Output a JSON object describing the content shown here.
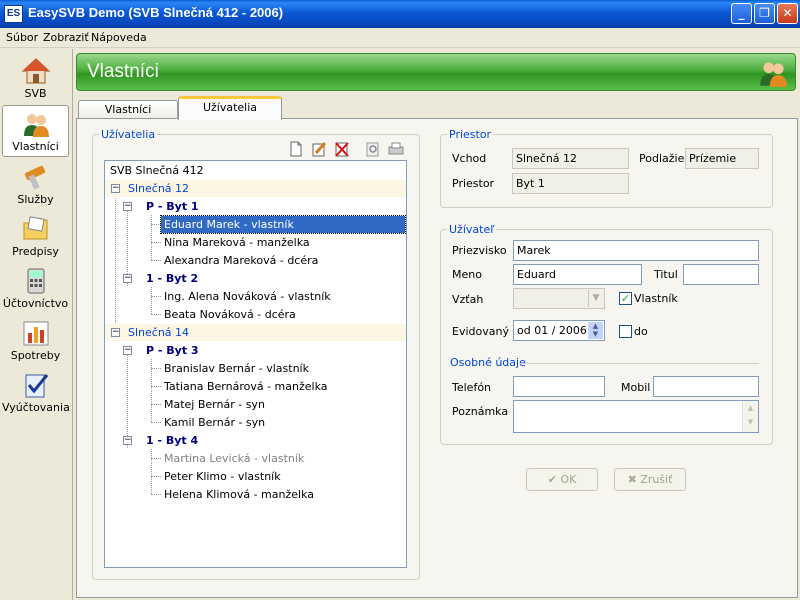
{
  "window": {
    "icon_text": "ES",
    "title": "EasySVB Demo  (SVB Slnečná 412 - 2006)"
  },
  "menu": [
    {
      "label": "Súbor"
    },
    {
      "label": "Zobraziť"
    },
    {
      "label": "Nápoveda"
    }
  ],
  "sidebar": {
    "items": [
      {
        "label": "SVB",
        "icon": "house-icon"
      },
      {
        "label": "Vlastníci",
        "icon": "owners-icon",
        "active": true
      },
      {
        "label": "Služby",
        "icon": "tools-icon"
      },
      {
        "label": "Predpisy",
        "icon": "folder-icon"
      },
      {
        "label": "Účtovníctvo",
        "icon": "calculator-icon"
      },
      {
        "label": "Spotreby",
        "icon": "bar-chart-icon"
      },
      {
        "label": "Vyúčtovania",
        "icon": "checklist-icon"
      }
    ]
  },
  "header": {
    "title": "Vlastníci"
  },
  "tabs": [
    {
      "label": "Vlastníci"
    },
    {
      "label": "Užívatelia",
      "active": true
    }
  ],
  "users_panel": {
    "legend": "Užívatelia",
    "tree": [
      {
        "label": "SVB Slnečná 412",
        "level": 0,
        "type": "root"
      },
      {
        "label": "Slnečná 12",
        "level": 1,
        "type": "group"
      },
      {
        "label": "P - Byt 1",
        "level": 2,
        "type": "unit"
      },
      {
        "label": "Eduard Marek - vlastník",
        "level": 3,
        "type": "person",
        "selected": true
      },
      {
        "label": "Nina Mareková - manželka",
        "level": 3,
        "type": "person"
      },
      {
        "label": "Alexandra Mareková - dcéra",
        "level": 3,
        "type": "person"
      },
      {
        "label": "1 - Byt 2",
        "level": 2,
        "type": "unit"
      },
      {
        "label": "Ing. Alena Nováková - vlastník",
        "level": 3,
        "type": "person"
      },
      {
        "label": "Beata Nováková - dcéra",
        "level": 3,
        "type": "person"
      },
      {
        "label": "Slnečná 14",
        "level": 1,
        "type": "group"
      },
      {
        "label": "P - Byt 3",
        "level": 2,
        "type": "unit"
      },
      {
        "label": "Branislav Bernár - vlastník",
        "level": 3,
        "type": "person"
      },
      {
        "label": "Tatiana Bernárová - manželka",
        "level": 3,
        "type": "person"
      },
      {
        "label": "Matej Bernár - syn",
        "level": 3,
        "type": "person"
      },
      {
        "label": "Kamil Bernár - syn",
        "level": 3,
        "type": "person"
      },
      {
        "label": "1 - Byt 4",
        "level": 2,
        "type": "unit"
      },
      {
        "label": "Martina Levická - vlastník",
        "level": 3,
        "type": "person",
        "inactive": true
      },
      {
        "label": "Peter Klimo - vlastník",
        "level": 3,
        "type": "person"
      },
      {
        "label": "Helena Klimová - manželka",
        "level": 3,
        "type": "person"
      }
    ]
  },
  "priestor": {
    "legend": "Priestor",
    "vchod_label": "Vchod",
    "vchod": "Slnečná 12",
    "podlazie_label": "Podlažie",
    "podlazie": "Prízemie",
    "priestor_label": "Priestor",
    "priestor": "Byt 1"
  },
  "uzivatel": {
    "legend": "Užívateľ",
    "priezvisko_label": "Priezvisko",
    "priezvisko": "Marek",
    "meno_label": "Meno",
    "meno": "Eduard",
    "titul_label": "Titul",
    "titul": "",
    "vztah_label": "Vzťah",
    "vztah": "",
    "vlastnik_label": "Vlastník",
    "vlastnik_checked": true,
    "evidovany_label": "Evidovaný",
    "evidovany": "od 01 / 2006",
    "do_label": "do",
    "do_checked": false,
    "osobne_label": "Osobné údaje",
    "telefon_label": "Telefón",
    "telefon": "",
    "mobil_label": "Mobil",
    "mobil": "",
    "poznamka_label": "Poznámka",
    "poznamka": ""
  },
  "actions": {
    "ok": "OK",
    "cancel": "Zrušiť"
  },
  "colors": {
    "accent": "#0046d5",
    "header_green": "#4cae3c",
    "selection": "#316ac5"
  }
}
